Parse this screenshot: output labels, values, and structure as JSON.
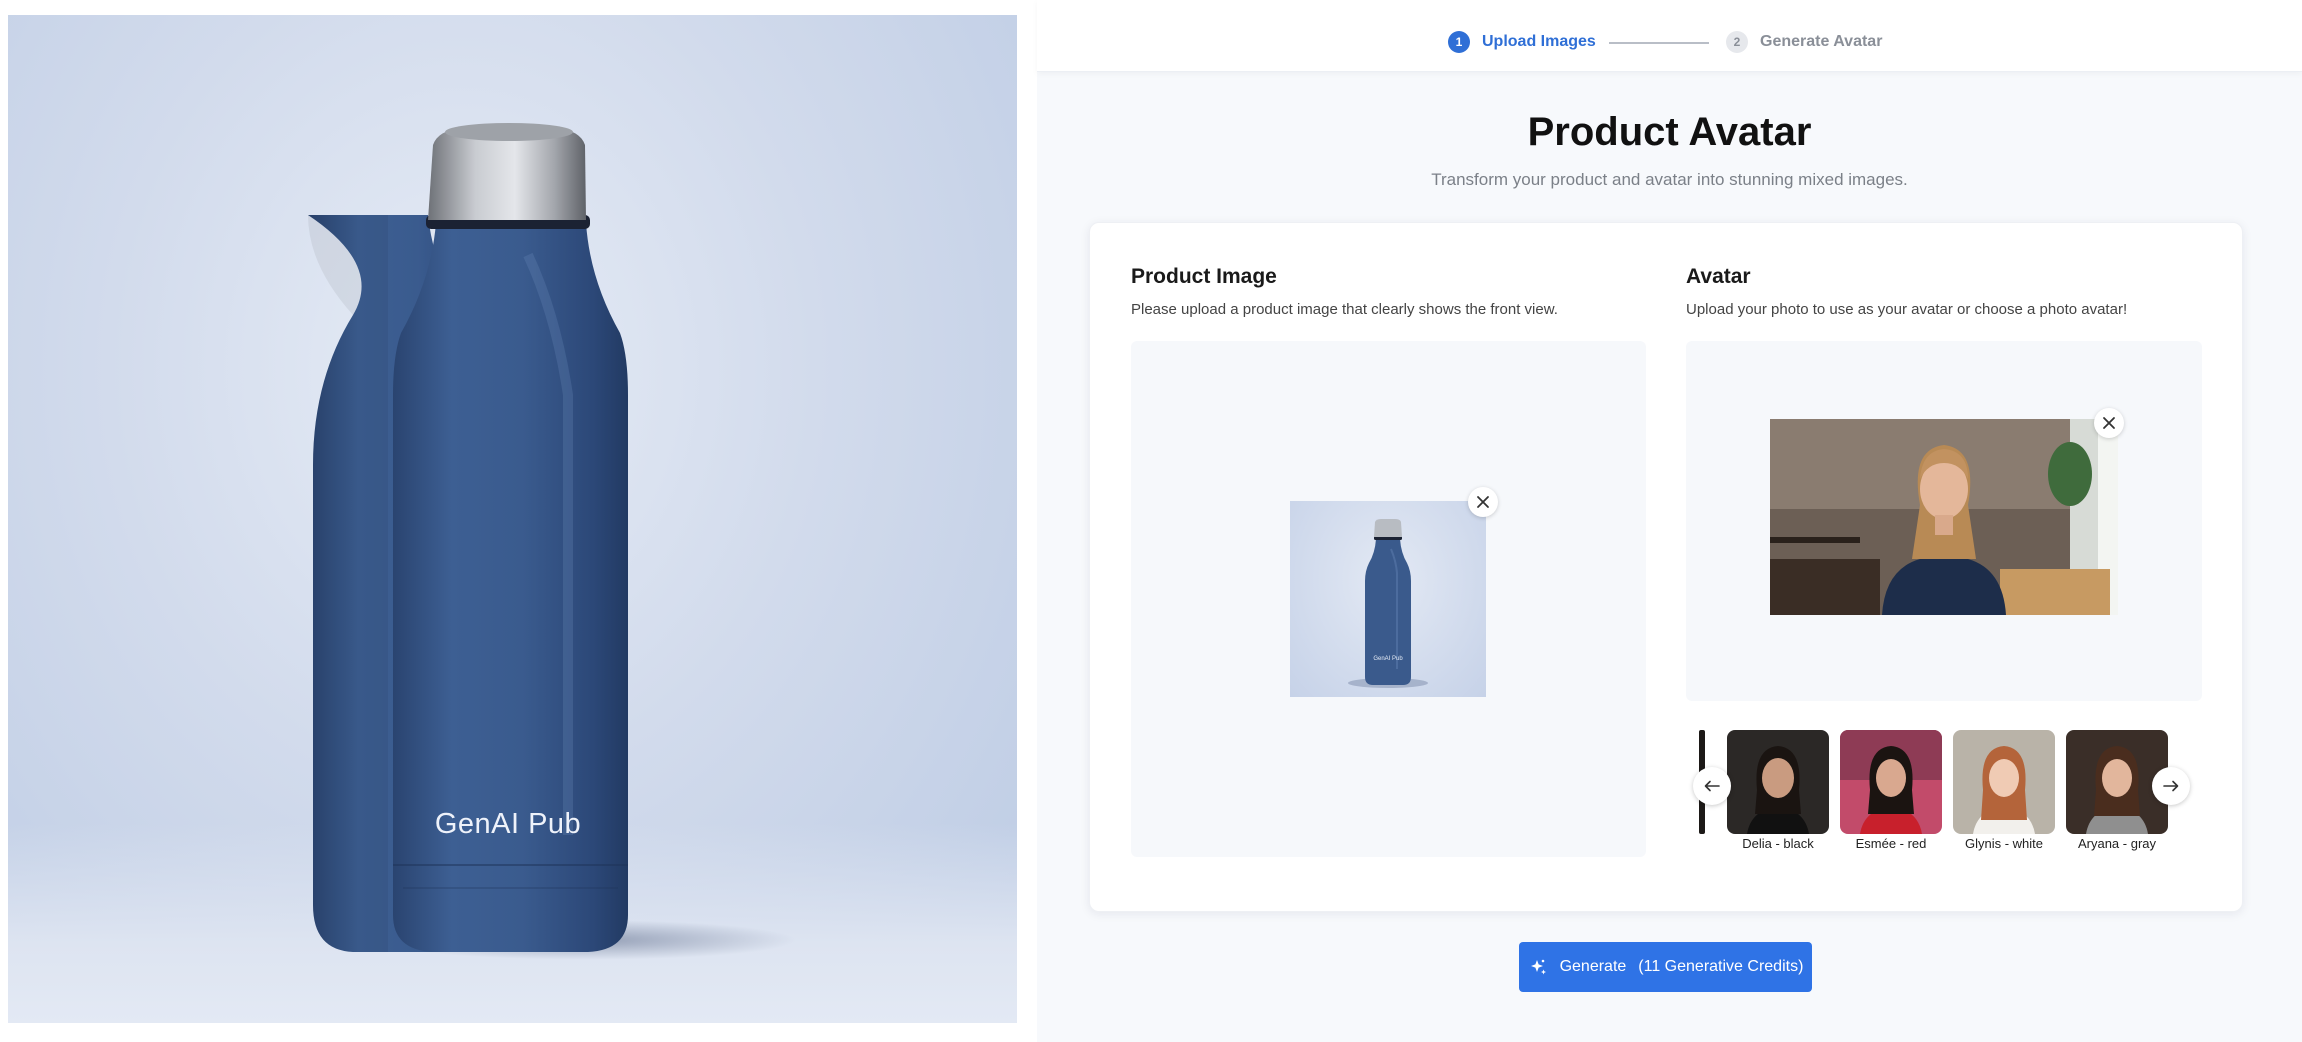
{
  "hero": {
    "brand_text": "GenAI Pub",
    "colors": {
      "bottle": "#3a5a8c",
      "background": "#d2dbec",
      "cap": "#b8bcc2"
    }
  },
  "stepper": {
    "steps": [
      {
        "number": "1",
        "label": "Upload Images",
        "state": "active"
      },
      {
        "number": "2",
        "label": "Generate Avatar",
        "state": "inactive"
      }
    ]
  },
  "page": {
    "title": "Product Avatar",
    "subtitle": "Transform your product and avatar into stunning mixed images."
  },
  "product": {
    "title": "Product Image",
    "description": "Please upload a product image that clearly shows the front view.",
    "thumb_brand": "GenAI Pub",
    "remove_icon": "close-icon"
  },
  "avatar": {
    "title": "Avatar",
    "description": "Upload your photo to use as your avatar or choose a photo avatar!",
    "remove_icon": "close-icon",
    "presets": [
      {
        "label": "Delia - black",
        "bg": "#2b2826",
        "top": "#111111"
      },
      {
        "label": "Esmée - red",
        "bg": "#c24b6a",
        "top": "#c8202c"
      },
      {
        "label": "Glynis - white",
        "bg": "#b9b3a8",
        "top": "#f2f0ec"
      },
      {
        "label": "Aryana - gray",
        "bg": "#3a2e28",
        "top": "#8f8f8f"
      }
    ],
    "prev_icon": "arrow-left-icon",
    "next_icon": "arrow-right-icon"
  },
  "actions": {
    "generate_label": "Generate",
    "generate_credits": "(11 Generative Credits)",
    "generate_icon": "sparkle-icon",
    "accent": "#2f73e6"
  }
}
